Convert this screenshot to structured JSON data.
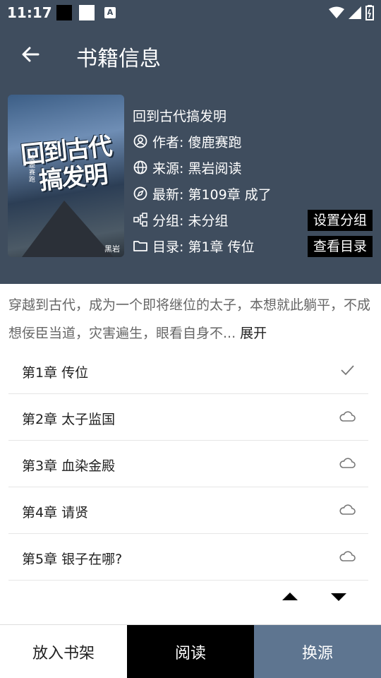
{
  "status_bar": {
    "time": "11:17",
    "badge": "A"
  },
  "header": {
    "title": "书籍信息"
  },
  "book": {
    "cover_title_line1": "回到古代",
    "cover_title_line2": "搞发明",
    "cover_author": "傻鹿赛跑",
    "cover_brand": "黑岩",
    "name": "回到古代搞发明",
    "author": "作者: 傻鹿赛跑",
    "source": "来源: 黑岩阅读",
    "latest": "最新: 第109章 成了",
    "group": "分组: 未分组",
    "toc": "目录: 第1章 传位",
    "set_group_label": "设置分组",
    "view_toc_label": "查看目录"
  },
  "intro": {
    "text": "穿越到古代，成为一个即将继位的太子，本想就此躺平，不成想佞臣当道，灾害遍生，眼看自身不...",
    "expand_label": "展开"
  },
  "chapters": [
    {
      "name": "第1章 传位",
      "status": "check-icon"
    },
    {
      "name": "第2章 太子监国",
      "status": "cloud-icon"
    },
    {
      "name": "第3章 血染金殿",
      "status": "cloud-icon"
    },
    {
      "name": "第4章 请贤",
      "status": "cloud-icon"
    },
    {
      "name": "第5章 银子在哪?",
      "status": "cloud-icon"
    }
  ],
  "bottom": {
    "shelf_label": "放入书架",
    "read_label": "阅读",
    "source_label": "换源"
  },
  "colors": {
    "header_bg": "#3f4d5e",
    "source_button_bg": "#5e7590"
  }
}
